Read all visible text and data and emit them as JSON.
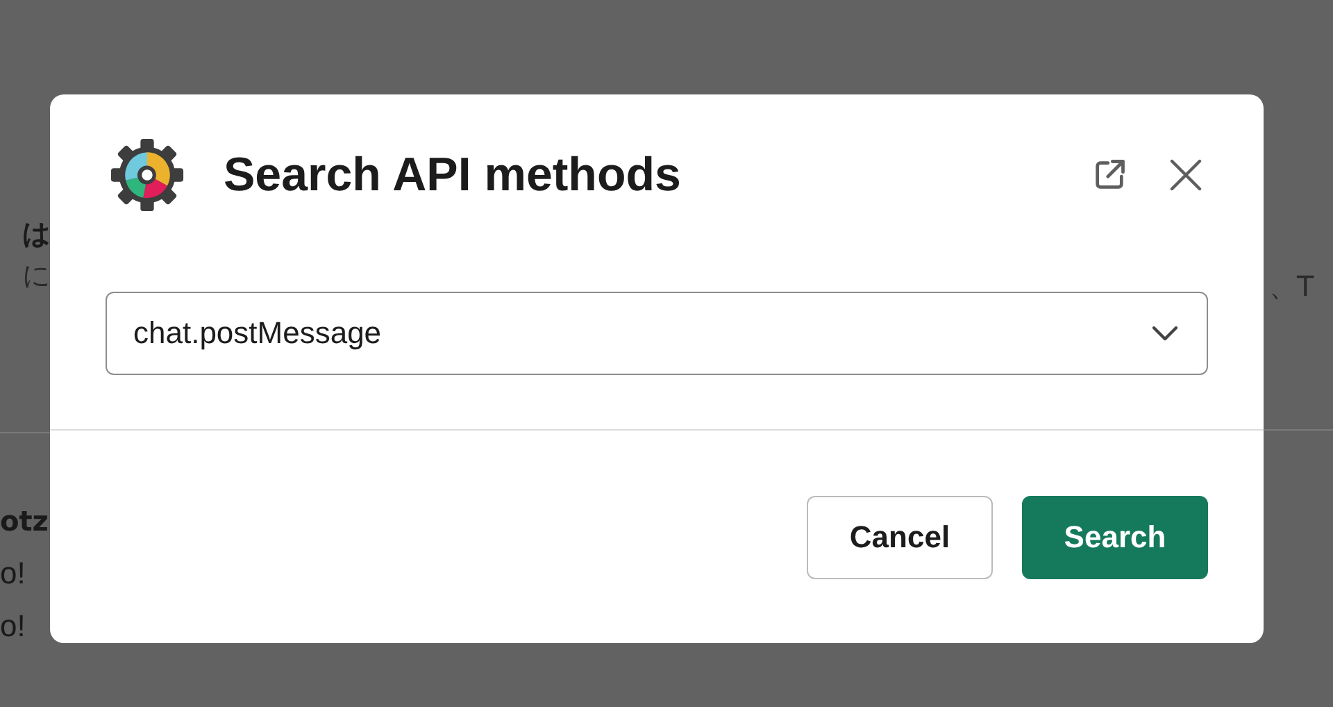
{
  "background": {
    "heading_fragment": "は",
    "line_fragment": "に",
    "right_fragment": "、T",
    "author_fragment": "otz",
    "messages": [
      "o!",
      "o!"
    ]
  },
  "dialog": {
    "title": "Search API methods",
    "method_select": {
      "value": "chat.postMessage"
    },
    "buttons": [
      {
        "label": "Cancel",
        "kind": "secondary"
      },
      {
        "label": "Search",
        "kind": "primary"
      }
    ]
  }
}
